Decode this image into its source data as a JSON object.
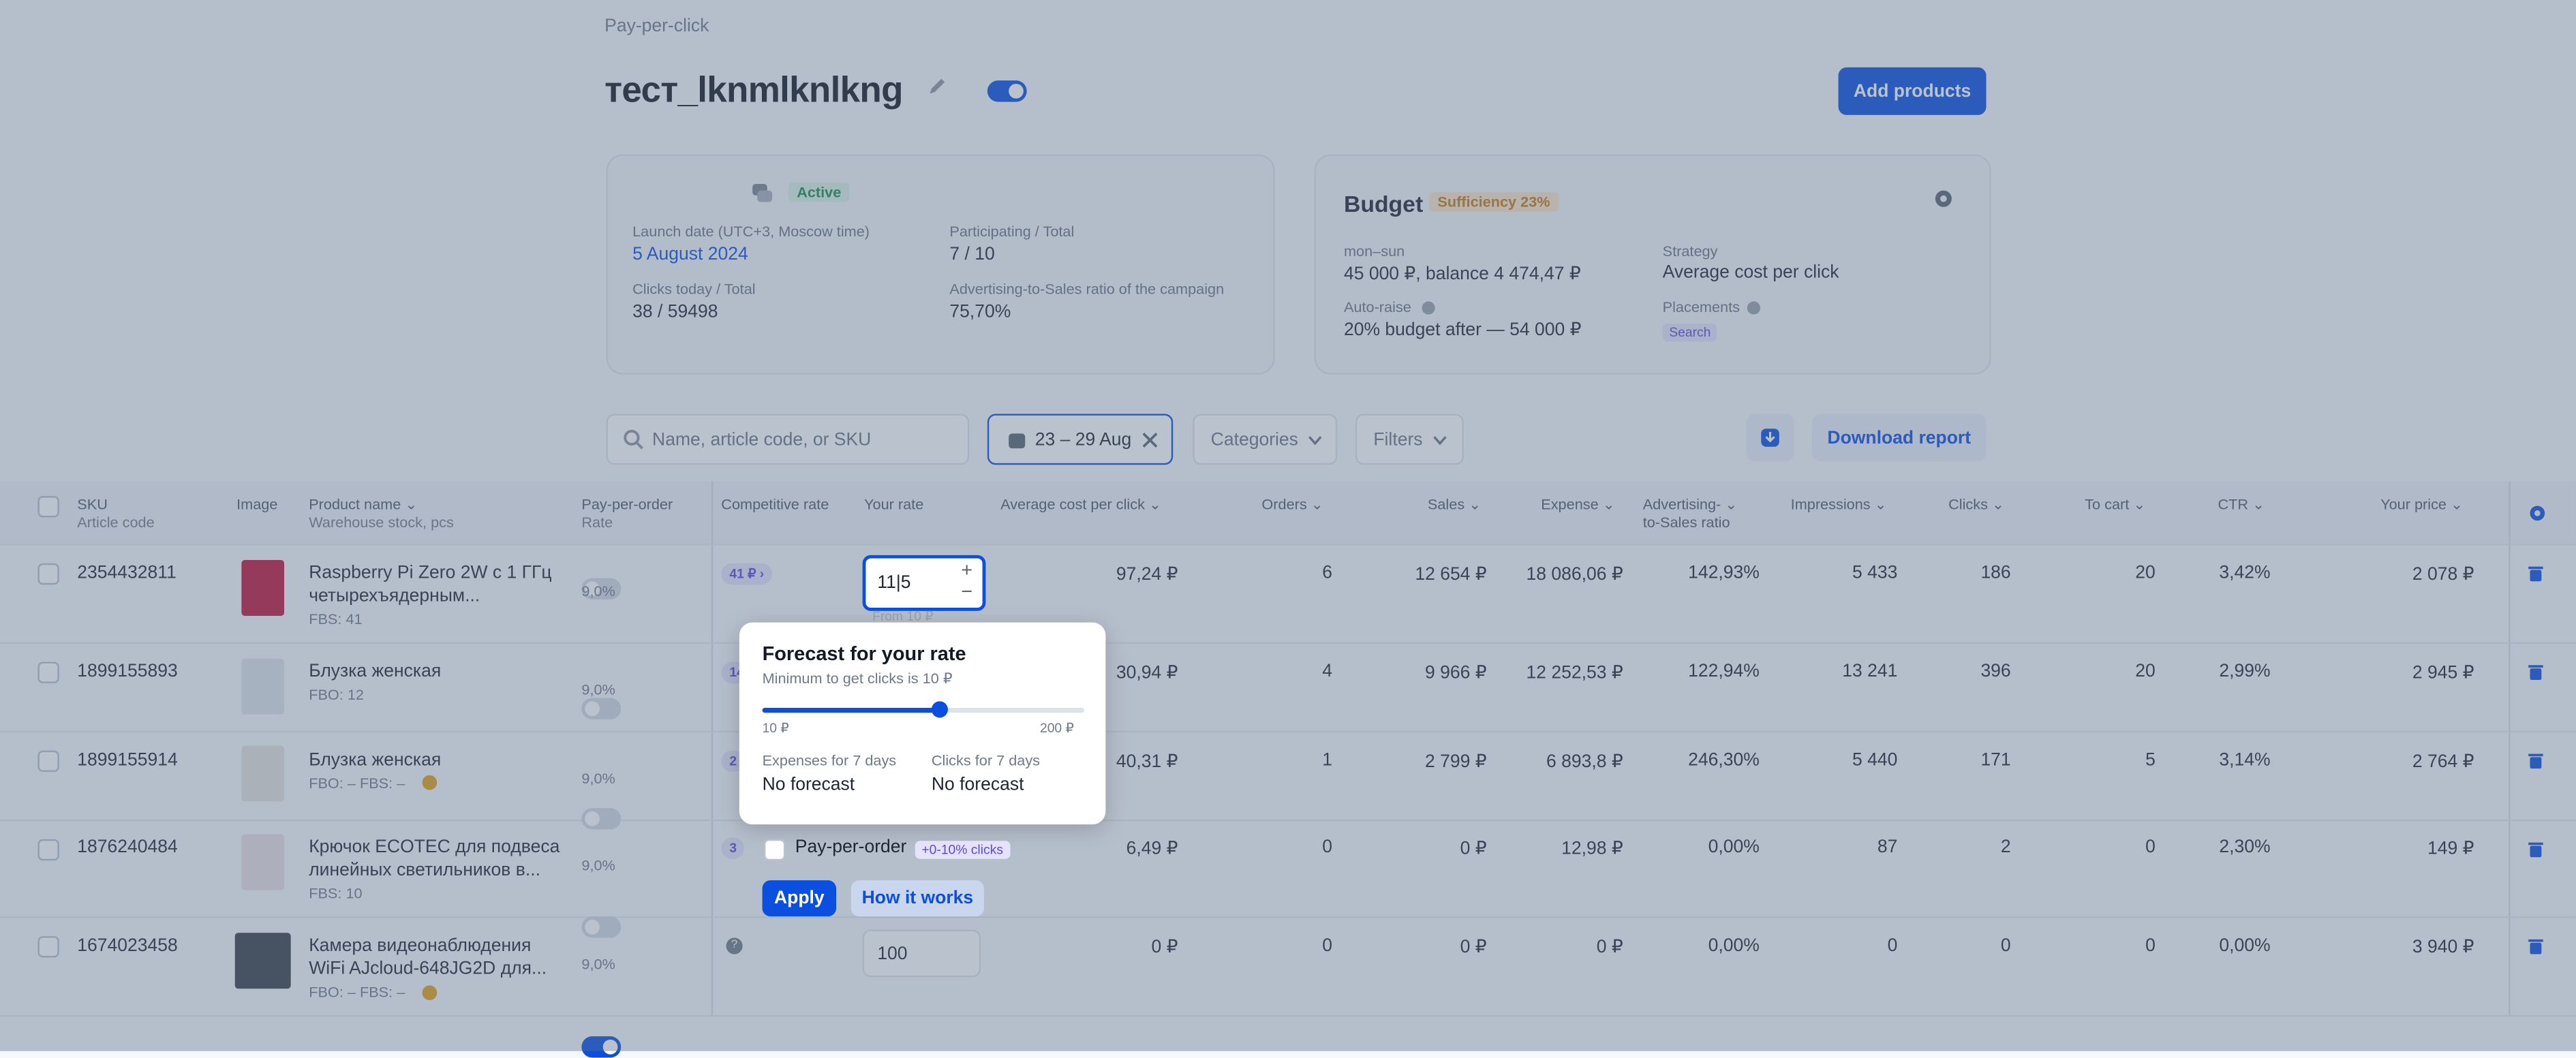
{
  "breadcrumb": "Pay-per-click",
  "campaign": {
    "title": "тест_lknmlknlkng",
    "add_products": "Add products"
  },
  "info_card": {
    "status": "Active",
    "launch_label": "Launch date (UTC+3, Moscow time)",
    "launch_value": "5 August 2024",
    "participating_label": "Participating / Total",
    "participating_value": "7 / 10",
    "clicks_label": "Clicks today / Total",
    "clicks_value": "38 / 59498",
    "ratio_label": "Advertising-to-Sales ratio of the campaign",
    "ratio_value": "75,70%"
  },
  "budget_card": {
    "title": "Budget",
    "sufficiency": "Sufficiency 23%",
    "period_label": "mon–sun",
    "period_value": "45 000 ₽, balance 4 474,47 ₽",
    "strategy_label": "Strategy",
    "strategy_value": "Average cost per click",
    "autoraise_label": "Auto-raise",
    "autoraise_value": "20% budget after — 54 000 ₽",
    "placements_label": "Placements",
    "placements_value": "Search"
  },
  "toolbar": {
    "search_placeholder": "Name, article code, or SKU",
    "date_range": "23 – 29 Aug",
    "categories": "Categories",
    "filters": "Filters",
    "download": "Download report"
  },
  "columns": {
    "sku": "SKU",
    "article": "Article code",
    "image": "Image",
    "product": "Product name",
    "warehouse": "Warehouse stock, pcs",
    "ppo": "Pay-per-order",
    "rate": "Rate",
    "competitive": "Competitive rate",
    "your_rate": "Your rate",
    "avg_cpc": "Average cost per click",
    "orders": "Orders",
    "sales": "Sales",
    "expense": "Expense",
    "ats1": "Advertising-",
    "ats2": "to-Sales ratio",
    "impressions": "Impressions",
    "clicks": "Clicks",
    "to_cart": "To cart",
    "ctr": "CTR",
    "price": "Your price"
  },
  "rows": [
    {
      "sku": "2354432811",
      "name1": "Raspberry Pi Zero 2W с 1 ГГц",
      "name2": "четырехъядерным...",
      "stock": "FBS: 41",
      "rate": "9,0%",
      "comp": "41 ₽",
      "your_rate": "11|5",
      "rate_hint": "From 10 ₽",
      "avg": "97,24 ₽",
      "orders": "6",
      "sales": "12 654 ₽",
      "expense": "18 086,06 ₽",
      "ats": "142,93%",
      "impr": "5 433",
      "clicks": "186",
      "cart": "20",
      "ctr": "3,42%",
      "price": "2 078 ₽"
    },
    {
      "sku": "1899155893",
      "name1": "Блузка женская",
      "name2": "",
      "stock": "FBO: 12",
      "rate": "9,0%",
      "comp": "14",
      "avg": "30,94 ₽",
      "orders": "4",
      "sales": "9 966 ₽",
      "expense": "12 252,53 ₽",
      "ats": "122,94%",
      "impr": "13 241",
      "clicks": "396",
      "cart": "20",
      "ctr": "2,99%",
      "price": "2 945 ₽"
    },
    {
      "sku": "1899155914",
      "name1": "Блузка женская",
      "name2": "",
      "stock": "FBO: –   FBS: –",
      "rate": "9,0%",
      "comp": "2",
      "avg": "40,31 ₽",
      "orders": "1",
      "sales": "2 799 ₽",
      "expense": "6 893,8 ₽",
      "ats": "246,30%",
      "impr": "5 440",
      "clicks": "171",
      "cart": "5",
      "ctr": "3,14%",
      "price": "2 764 ₽"
    },
    {
      "sku": "1876240484",
      "name1": "Крючок ECOTEC для подвеса",
      "name2": "линейных светильников в...",
      "stock": "FBS: 10",
      "rate": "9,0%",
      "comp": "3",
      "avg": "6,49 ₽",
      "orders": "0",
      "sales": "0 ₽",
      "expense": "12,98 ₽",
      "ats": "0,00%",
      "impr": "87",
      "clicks": "2",
      "cart": "0",
      "ctr": "2,30%",
      "price": "149 ₽"
    },
    {
      "sku": "1674023458",
      "name1": "Камера видеонаблюдения",
      "name2": "WiFi AJcloud-648JG2D для...",
      "stock": "FBO: –   FBS: –",
      "rate": "9,0%",
      "comp": "?",
      "your_rate": "100",
      "avg": "0 ₽",
      "orders": "0",
      "sales": "0 ₽",
      "expense": "0 ₽",
      "ats": "0,00%",
      "impr": "0",
      "clicks": "0",
      "cart": "0",
      "ctr": "0,00%",
      "price": "3 940 ₽"
    }
  ],
  "forecast": {
    "title": "Forecast for your rate",
    "subtitle": "Minimum to get clicks is 10 ₽",
    "slider_min": "10 ₽",
    "slider_max": "200 ₽",
    "slider_value": 0.55,
    "expenses_label": "Expenses for 7 days",
    "expenses_value": "No forecast",
    "clicks_label": "Clicks for 7 days",
    "clicks_value": "No forecast",
    "ppo_label": "Pay-per-order",
    "ppo_badge": "+0-10% clicks",
    "apply": "Apply",
    "how": "How it works"
  },
  "colors": {
    "accent": "#0a4fe0",
    "active": "#1c8a4a",
    "warning": "#c47b14",
    "overlay": "#5a6e87"
  }
}
